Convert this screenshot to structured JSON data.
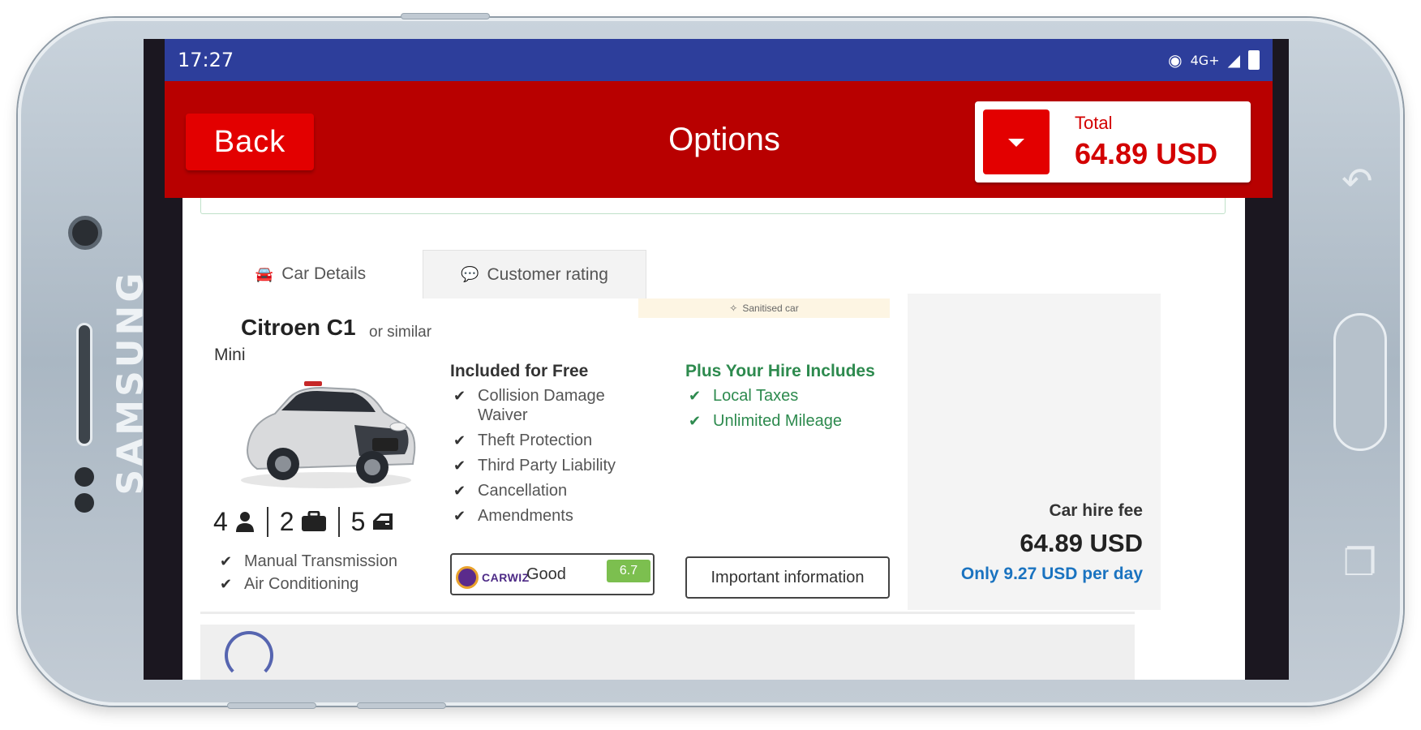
{
  "device": {
    "brand": "SAMSUNG"
  },
  "status_bar": {
    "time": "17:27",
    "network": "4G+",
    "icons": [
      "eye-icon",
      "network-icon",
      "signal-icon",
      "battery-icon"
    ]
  },
  "header": {
    "back_label": "Back",
    "title": "Options",
    "total_label": "Total",
    "total_value": "64.89 USD"
  },
  "tabs": [
    {
      "label": "Car Details",
      "icon": "car-icon"
    },
    {
      "label": "Customer rating",
      "icon": "chat-icon"
    }
  ],
  "car": {
    "name": "Citroen C1",
    "similar": "or similar",
    "class": "Mini",
    "sanitised_badge": "Sanitised car",
    "specs": {
      "seats": "4",
      "bags": "2",
      "doors": "5"
    },
    "features": [
      "Manual Transmission",
      "Air Conditioning"
    ]
  },
  "included": {
    "heading": "Included for Free",
    "items": [
      "Collision Damage Waiver",
      "Theft Protection",
      "Third Party Liability",
      "Cancellation",
      "Amendments"
    ]
  },
  "plus": {
    "heading": "Plus Your Hire Includes",
    "items": [
      "Local Taxes",
      "Unlimited Mileage"
    ]
  },
  "rating": {
    "provider": "CARWIZ",
    "word": "Good",
    "score": "6.7"
  },
  "important_label": "Important information",
  "price": {
    "fee_label": "Car hire fee",
    "fee_value": "64.89 USD",
    "per_day": "Only 9.27 USD per day"
  },
  "colors": {
    "header_red": "#b80000",
    "button_red": "#e30000",
    "status_blue": "#2d3e9b",
    "green": "#2d8a4e",
    "link_blue": "#1a73c0"
  }
}
